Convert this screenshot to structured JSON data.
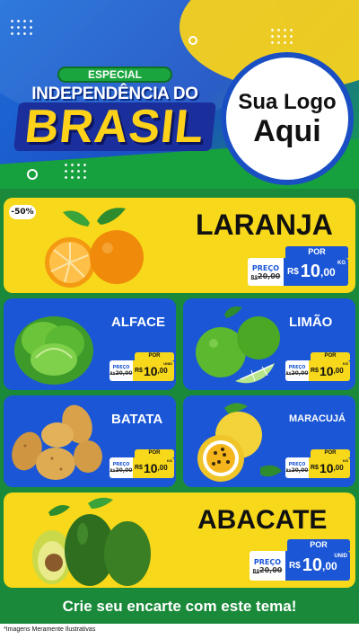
{
  "header": {
    "especial": "ESPECIAL",
    "title_line": "INDEPENDÊNCIA DO",
    "title_big": "BRASIL",
    "logo_line1": "Sua Logo",
    "logo_line2": "Aqui"
  },
  "products": [
    {
      "name": "LARANJA",
      "badge": "-50%",
      "por": "POR",
      "preco": "PREÇO",
      "old_prefix": "R$",
      "old_price": "20,00",
      "currency": "R$",
      "price_int": "10",
      "price_dec": ",00",
      "unit": "KG"
    },
    {
      "name": "ALFACE",
      "por": "POR",
      "preco": "PREÇO",
      "old_prefix": "R$",
      "old_price": "20,00",
      "currency": "R$",
      "price_int": "10",
      "price_dec": ",00",
      "unit": "UNID"
    },
    {
      "name": "LIMÃO",
      "por": "POR",
      "preco": "PREÇO",
      "old_prefix": "R$",
      "old_price": "20,00",
      "currency": "R$",
      "price_int": "10",
      "price_dec": ",00",
      "unit": "KG"
    },
    {
      "name": "BATATA",
      "por": "POR",
      "preco": "PREÇO",
      "old_prefix": "R$",
      "old_price": "20,00",
      "currency": "R$",
      "price_int": "10",
      "price_dec": ",00",
      "unit": "KG"
    },
    {
      "name": "MARACUJÁ",
      "por": "POR",
      "preco": "PREÇO",
      "old_prefix": "R$",
      "old_price": "20,00",
      "currency": "R$",
      "price_int": "10",
      "price_dec": ",00",
      "unit": "KG"
    },
    {
      "name": "ABACATE",
      "por": "POR",
      "preco": "PREÇO",
      "old_prefix": "R$",
      "old_price": "20,00",
      "currency": "R$",
      "price_int": "10",
      "price_dec": ",00",
      "unit": "UNID"
    }
  ],
  "footer": {
    "banner": "Crie seu encarte com este tema!",
    "disclaimer": "*Imagens Meramente Ilustrativas"
  },
  "colors": {
    "brand_blue": "#1a56d6",
    "brand_yellow": "#f7d81a",
    "brand_green": "#1a8a3a"
  }
}
